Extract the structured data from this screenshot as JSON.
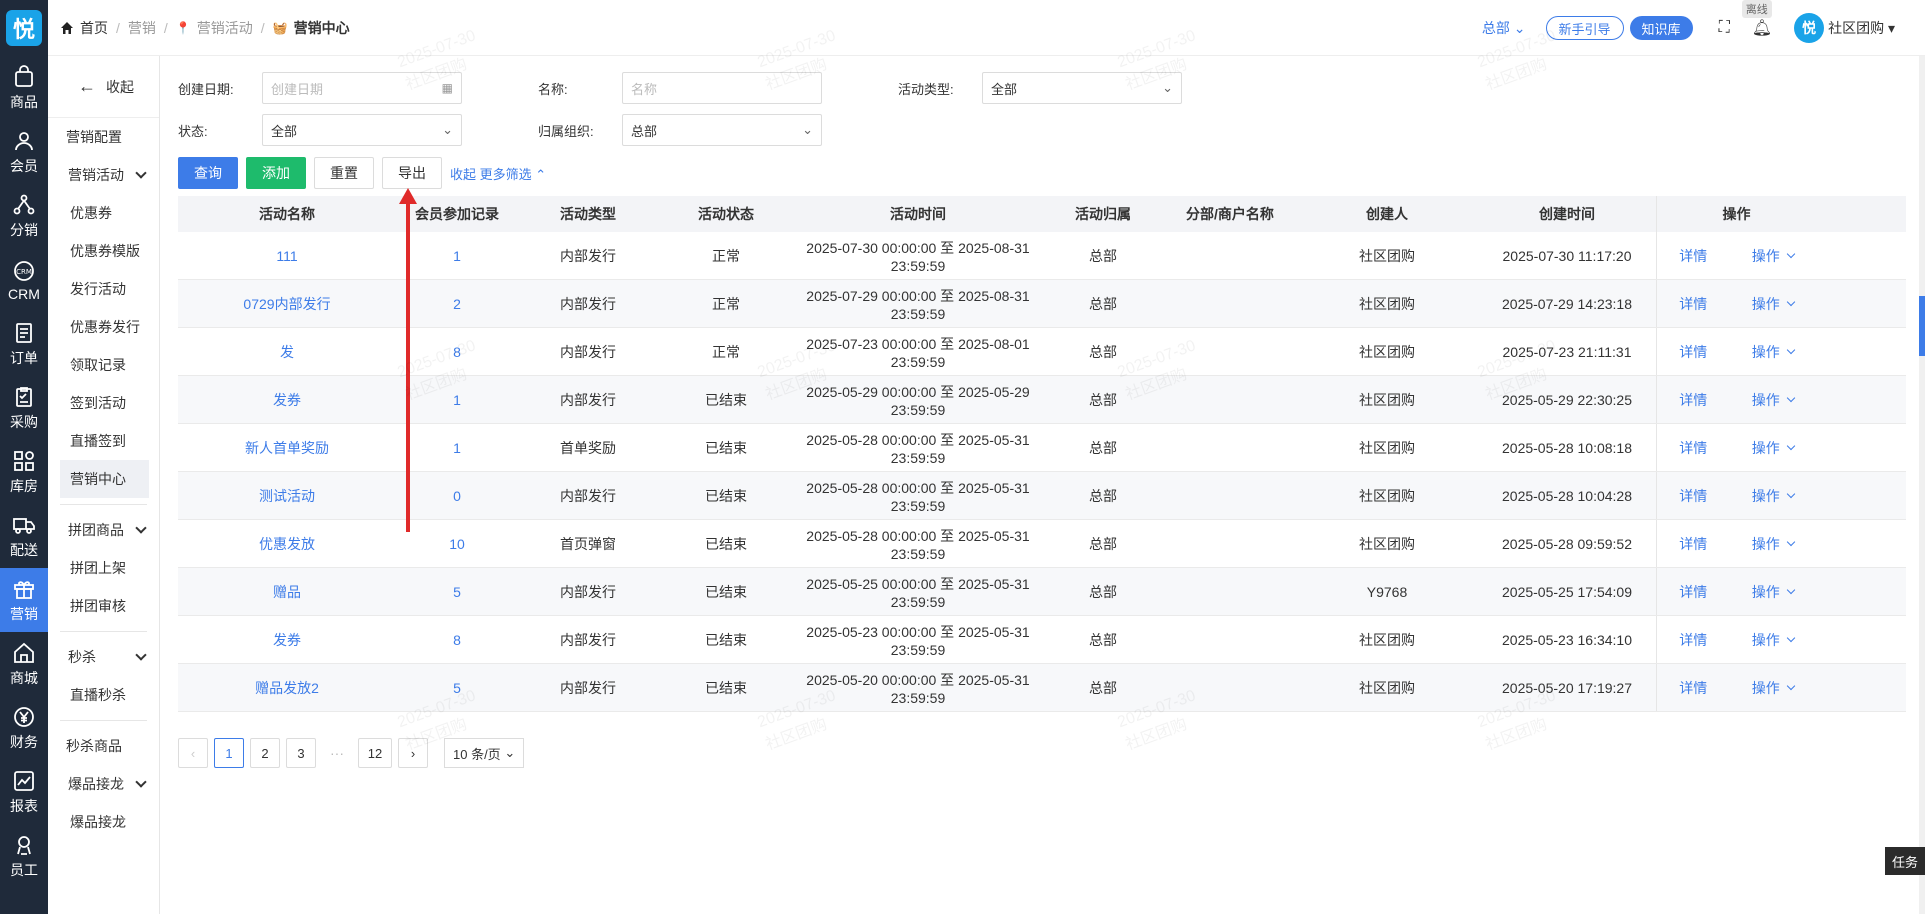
{
  "nav": {
    "logo": "悦",
    "items": [
      {
        "label": "商品",
        "icon": "bag-icon"
      },
      {
        "label": "会员",
        "icon": "user-icon"
      },
      {
        "label": "分销",
        "icon": "share-icon"
      },
      {
        "label": "CRM",
        "icon": "crm-icon"
      },
      {
        "label": "订单",
        "icon": "order-icon"
      },
      {
        "label": "采购",
        "icon": "purchase-icon"
      },
      {
        "label": "库房",
        "icon": "warehouse-icon"
      },
      {
        "label": "配送",
        "icon": "truck-icon"
      },
      {
        "label": "营销",
        "icon": "gift-icon"
      },
      {
        "label": "商城",
        "icon": "shop-icon"
      },
      {
        "label": "财务",
        "icon": "yen-icon"
      },
      {
        "label": "报表",
        "icon": "chart-icon"
      },
      {
        "label": "员工",
        "icon": "staff-icon"
      }
    ]
  },
  "submenu": {
    "collapse": "收起",
    "config": "营销配置",
    "group1": "营销活动",
    "g1items": [
      "优惠券",
      "优惠券模版",
      "发行活动",
      "优惠券发行",
      "领取记录",
      "签到活动",
      "直播签到",
      "营销中心"
    ],
    "group2": "拼团商品",
    "g2items": [
      "拼团上架",
      "拼团审核"
    ],
    "group3": "秒杀",
    "g3items": [
      "直播秒杀"
    ],
    "seckill_goods": "秒杀商品",
    "group4": "爆品接龙",
    "g4items": [
      "爆品接龙"
    ]
  },
  "header": {
    "crumbs": [
      "首页",
      "营销",
      "营销活动",
      "营销中心"
    ],
    "hq": "总部",
    "guide": "新手引导",
    "kb": "知识库",
    "offline": "离线",
    "avatar": "悦",
    "user": "社区团购"
  },
  "filters": {
    "date_label": "创建日期:",
    "date_ph": "创建日期",
    "name_label": "名称:",
    "name_ph": "名称",
    "type_label": "活动类型:",
    "type_value": "全部",
    "status_label": "状态:",
    "status_value": "全部",
    "org_label": "归属组织:",
    "org_value": "总部"
  },
  "buttons": {
    "query": "查询",
    "add": "添加",
    "reset": "重置",
    "export": "导出",
    "more": "收起 更多筛选"
  },
  "table": {
    "headers": [
      "活动名称",
      "会员参加记录",
      "活动类型",
      "活动状态",
      "活动时间",
      "活动归属",
      "分部/商户名称",
      "创建人",
      "创建时间",
      "操作"
    ],
    "detail": "详情",
    "op": "操作",
    "rows": [
      [
        "111",
        "1",
        "内部发行",
        "正常",
        "2025-07-30 00:00:00 至 2025-08-31 23:59:59",
        "总部",
        "",
        "社区团购",
        "2025-07-30 11:17:20"
      ],
      [
        "0729内部发行",
        "2",
        "内部发行",
        "正常",
        "2025-07-29 00:00:00 至 2025-08-31 23:59:59",
        "总部",
        "",
        "社区团购",
        "2025-07-29 14:23:18"
      ],
      [
        "发",
        "8",
        "内部发行",
        "正常",
        "2025-07-23 00:00:00 至 2025-08-01 23:59:59",
        "总部",
        "",
        "社区团购",
        "2025-07-23 21:11:31"
      ],
      [
        "发券",
        "1",
        "内部发行",
        "已结束",
        "2025-05-29 00:00:00 至 2025-05-29 23:59:59",
        "总部",
        "",
        "社区团购",
        "2025-05-29 22:30:25"
      ],
      [
        "新人首单奖励",
        "1",
        "首单奖励",
        "已结束",
        "2025-05-28 00:00:00 至 2025-05-31 23:59:59",
        "总部",
        "",
        "社区团购",
        "2025-05-28 10:08:18"
      ],
      [
        "测试活动",
        "0",
        "内部发行",
        "已结束",
        "2025-05-28 00:00:00 至 2025-05-31 23:59:59",
        "总部",
        "",
        "社区团购",
        "2025-05-28 10:04:28"
      ],
      [
        "优惠发放",
        "10",
        "首页弹窗",
        "已结束",
        "2025-05-28 00:00:00 至 2025-05-31 23:59:59",
        "总部",
        "",
        "社区团购",
        "2025-05-28 09:59:52"
      ],
      [
        "赠品",
        "5",
        "内部发行",
        "已结束",
        "2025-05-25 00:00:00 至 2025-05-31 23:59:59",
        "总部",
        "",
        "Y9768",
        "2025-05-25 17:54:09"
      ],
      [
        "发券",
        "8",
        "内部发行",
        "已结束",
        "2025-05-23 00:00:00 至 2025-05-31 23:59:59",
        "总部",
        "",
        "社区团购",
        "2025-05-23 16:34:10"
      ],
      [
        "赠品发放2",
        "5",
        "内部发行",
        "已结束",
        "2025-05-20 00:00:00 至 2025-05-31 23:59:59",
        "总部",
        "",
        "社区团购",
        "2025-05-20 17:19:27"
      ]
    ]
  },
  "pager": {
    "prev": "‹",
    "pages": [
      "1",
      "2",
      "3"
    ],
    "ellipsis": "···",
    "last": "12",
    "next": "›",
    "size": "10 条/页"
  },
  "task": "任务",
  "watermark": [
    "2025-07-30",
    "社区团购"
  ],
  "colors": {
    "primary": "#3d7ce8",
    "green": "#1ebb6c",
    "nav": "#1f2a3a",
    "arrow": "#e02a2a"
  }
}
